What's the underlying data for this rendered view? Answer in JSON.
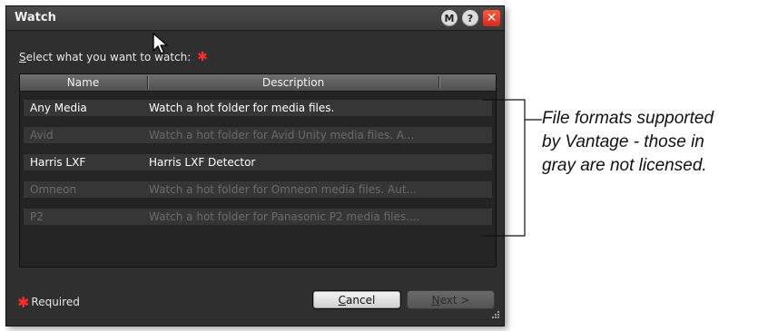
{
  "window": {
    "title": "Watch",
    "buttons": {
      "m": "M",
      "help": "?",
      "close": "✕"
    }
  },
  "prompt": {
    "label_first_letter": "S",
    "label_rest": "elect what you want to watch:",
    "required_marker": "✱"
  },
  "table": {
    "columns": [
      "Name",
      "Description"
    ],
    "rows": [
      {
        "name": "Any Media",
        "description": "Watch a hot folder for media files.",
        "licensed": true
      },
      {
        "name": "Avid",
        "description": "Watch a hot folder for Avid Unity media files. A...",
        "licensed": false
      },
      {
        "name": "Harris LXF",
        "description": "Harris LXF Detector",
        "licensed": true
      },
      {
        "name": "Omneon",
        "description": "Watch a hot folder for Omneon media files. Aut...",
        "licensed": false
      },
      {
        "name": "P2",
        "description": "Watch a hot folder for Panasonic P2 media files....",
        "licensed": false
      }
    ]
  },
  "footer": {
    "required_marker": "✱",
    "required_label": "Required",
    "cancel_underlined": "C",
    "cancel_rest": "ancel",
    "next_underlined": "N",
    "next_rest": "ext >"
  },
  "annotation": {
    "lines": [
      "File formats supported",
      "by Vantage - those in",
      "gray are not licensed."
    ]
  },
  "colors": {
    "licensed_text": "#ffffff",
    "unlicensed_text": "#6a6a6a",
    "required_star": "#ff2a2a",
    "close_button": "#e23a22"
  }
}
